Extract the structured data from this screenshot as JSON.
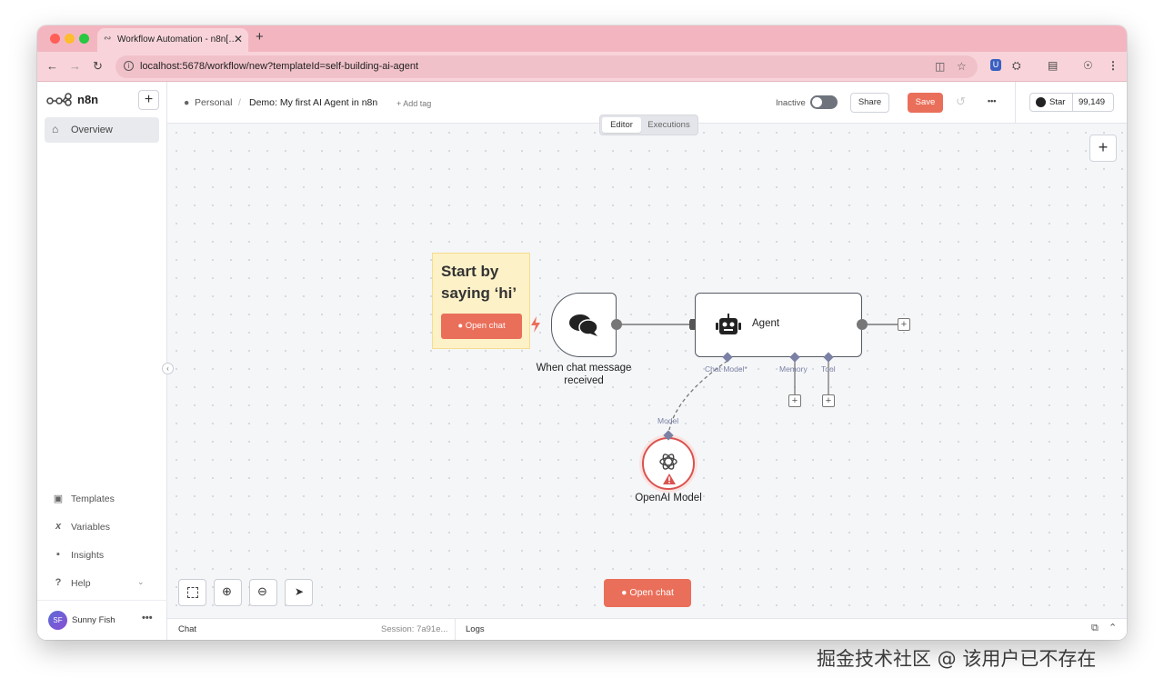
{
  "browser": {
    "tab_title": "Workflow Automation - n8n[…",
    "url": "localhost:5678/workflow/new?templateId=self-building-ai-agent",
    "tab_close": "✕",
    "new_tab": "+"
  },
  "sidebar": {
    "logo_text": "n8n",
    "overview_label": "Overview",
    "items": [
      {
        "label": "Templates",
        "icon": "templates-icon"
      },
      {
        "label": "Variables",
        "icon": "variables-icon"
      },
      {
        "label": "Insights",
        "icon": "insights-icon"
      },
      {
        "label": "Help",
        "icon": "help-icon"
      }
    ],
    "user": {
      "initials": "SF",
      "name": "Sunny Fish"
    }
  },
  "header": {
    "project": "Personal",
    "separator": "/",
    "workflow_name": "Demo: My first AI Agent in n8n",
    "add_tag": "+ Add tag",
    "status": "Inactive",
    "share_label": "Share",
    "save_label": "Save",
    "more": "•••",
    "github_star": "Star",
    "github_count": "99,149"
  },
  "canvas": {
    "modes": [
      "Editor",
      "Executions"
    ],
    "sticky_note": "Start by saying ‘hi’",
    "sticky_button": "Open chat",
    "nodes": {
      "trigger": {
        "label_line1": "When chat message",
        "label_line2": "received"
      },
      "agent": {
        "label": "Agent"
      },
      "model": {
        "label": "OpenAI Model"
      }
    },
    "handles": {
      "chat_model": "Chat Model*",
      "memory": "Memory",
      "tool": "Tool",
      "model": "Model"
    },
    "open_chat_button": "Open chat"
  },
  "bottom": {
    "chat": "Chat",
    "session": "Session: 7a91e...",
    "logs": "Logs"
  },
  "watermark": "掘金技术社区 @ 该用户已不存在",
  "colors": {
    "accent": "#ea6f5a",
    "browser_chrome": "#f3b6c0",
    "handle": "#7b81a4"
  }
}
